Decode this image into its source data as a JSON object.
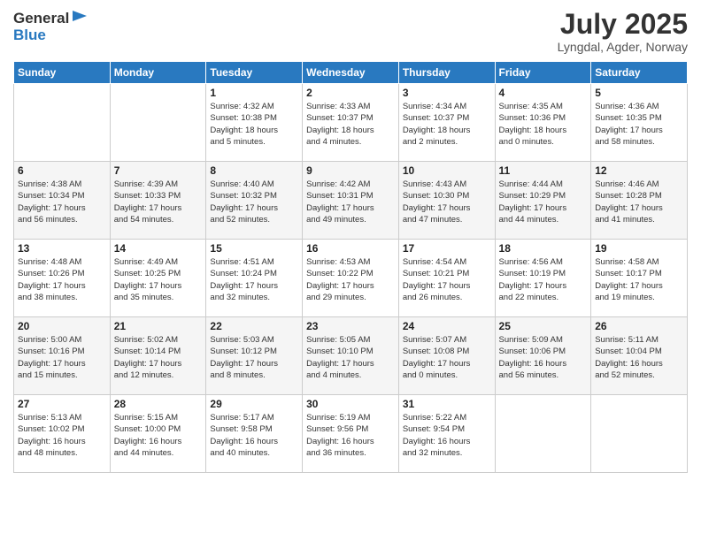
{
  "header": {
    "logo_line1": "General",
    "logo_line2": "Blue",
    "month": "July 2025",
    "location": "Lyngdal, Agder, Norway"
  },
  "days_of_week": [
    "Sunday",
    "Monday",
    "Tuesday",
    "Wednesday",
    "Thursday",
    "Friday",
    "Saturday"
  ],
  "weeks": [
    [
      {
        "day": "",
        "info": ""
      },
      {
        "day": "",
        "info": ""
      },
      {
        "day": "1",
        "info": "Sunrise: 4:32 AM\nSunset: 10:38 PM\nDaylight: 18 hours\nand 5 minutes."
      },
      {
        "day": "2",
        "info": "Sunrise: 4:33 AM\nSunset: 10:37 PM\nDaylight: 18 hours\nand 4 minutes."
      },
      {
        "day": "3",
        "info": "Sunrise: 4:34 AM\nSunset: 10:37 PM\nDaylight: 18 hours\nand 2 minutes."
      },
      {
        "day": "4",
        "info": "Sunrise: 4:35 AM\nSunset: 10:36 PM\nDaylight: 18 hours\nand 0 minutes."
      },
      {
        "day": "5",
        "info": "Sunrise: 4:36 AM\nSunset: 10:35 PM\nDaylight: 17 hours\nand 58 minutes."
      }
    ],
    [
      {
        "day": "6",
        "info": "Sunrise: 4:38 AM\nSunset: 10:34 PM\nDaylight: 17 hours\nand 56 minutes."
      },
      {
        "day": "7",
        "info": "Sunrise: 4:39 AM\nSunset: 10:33 PM\nDaylight: 17 hours\nand 54 minutes."
      },
      {
        "day": "8",
        "info": "Sunrise: 4:40 AM\nSunset: 10:32 PM\nDaylight: 17 hours\nand 52 minutes."
      },
      {
        "day": "9",
        "info": "Sunrise: 4:42 AM\nSunset: 10:31 PM\nDaylight: 17 hours\nand 49 minutes."
      },
      {
        "day": "10",
        "info": "Sunrise: 4:43 AM\nSunset: 10:30 PM\nDaylight: 17 hours\nand 47 minutes."
      },
      {
        "day": "11",
        "info": "Sunrise: 4:44 AM\nSunset: 10:29 PM\nDaylight: 17 hours\nand 44 minutes."
      },
      {
        "day": "12",
        "info": "Sunrise: 4:46 AM\nSunset: 10:28 PM\nDaylight: 17 hours\nand 41 minutes."
      }
    ],
    [
      {
        "day": "13",
        "info": "Sunrise: 4:48 AM\nSunset: 10:26 PM\nDaylight: 17 hours\nand 38 minutes."
      },
      {
        "day": "14",
        "info": "Sunrise: 4:49 AM\nSunset: 10:25 PM\nDaylight: 17 hours\nand 35 minutes."
      },
      {
        "day": "15",
        "info": "Sunrise: 4:51 AM\nSunset: 10:24 PM\nDaylight: 17 hours\nand 32 minutes."
      },
      {
        "day": "16",
        "info": "Sunrise: 4:53 AM\nSunset: 10:22 PM\nDaylight: 17 hours\nand 29 minutes."
      },
      {
        "day": "17",
        "info": "Sunrise: 4:54 AM\nSunset: 10:21 PM\nDaylight: 17 hours\nand 26 minutes."
      },
      {
        "day": "18",
        "info": "Sunrise: 4:56 AM\nSunset: 10:19 PM\nDaylight: 17 hours\nand 22 minutes."
      },
      {
        "day": "19",
        "info": "Sunrise: 4:58 AM\nSunset: 10:17 PM\nDaylight: 17 hours\nand 19 minutes."
      }
    ],
    [
      {
        "day": "20",
        "info": "Sunrise: 5:00 AM\nSunset: 10:16 PM\nDaylight: 17 hours\nand 15 minutes."
      },
      {
        "day": "21",
        "info": "Sunrise: 5:02 AM\nSunset: 10:14 PM\nDaylight: 17 hours\nand 12 minutes."
      },
      {
        "day": "22",
        "info": "Sunrise: 5:03 AM\nSunset: 10:12 PM\nDaylight: 17 hours\nand 8 minutes."
      },
      {
        "day": "23",
        "info": "Sunrise: 5:05 AM\nSunset: 10:10 PM\nDaylight: 17 hours\nand 4 minutes."
      },
      {
        "day": "24",
        "info": "Sunrise: 5:07 AM\nSunset: 10:08 PM\nDaylight: 17 hours\nand 0 minutes."
      },
      {
        "day": "25",
        "info": "Sunrise: 5:09 AM\nSunset: 10:06 PM\nDaylight: 16 hours\nand 56 minutes."
      },
      {
        "day": "26",
        "info": "Sunrise: 5:11 AM\nSunset: 10:04 PM\nDaylight: 16 hours\nand 52 minutes."
      }
    ],
    [
      {
        "day": "27",
        "info": "Sunrise: 5:13 AM\nSunset: 10:02 PM\nDaylight: 16 hours\nand 48 minutes."
      },
      {
        "day": "28",
        "info": "Sunrise: 5:15 AM\nSunset: 10:00 PM\nDaylight: 16 hours\nand 44 minutes."
      },
      {
        "day": "29",
        "info": "Sunrise: 5:17 AM\nSunset: 9:58 PM\nDaylight: 16 hours\nand 40 minutes."
      },
      {
        "day": "30",
        "info": "Sunrise: 5:19 AM\nSunset: 9:56 PM\nDaylight: 16 hours\nand 36 minutes."
      },
      {
        "day": "31",
        "info": "Sunrise: 5:22 AM\nSunset: 9:54 PM\nDaylight: 16 hours\nand 32 minutes."
      },
      {
        "day": "",
        "info": ""
      },
      {
        "day": "",
        "info": ""
      }
    ]
  ]
}
